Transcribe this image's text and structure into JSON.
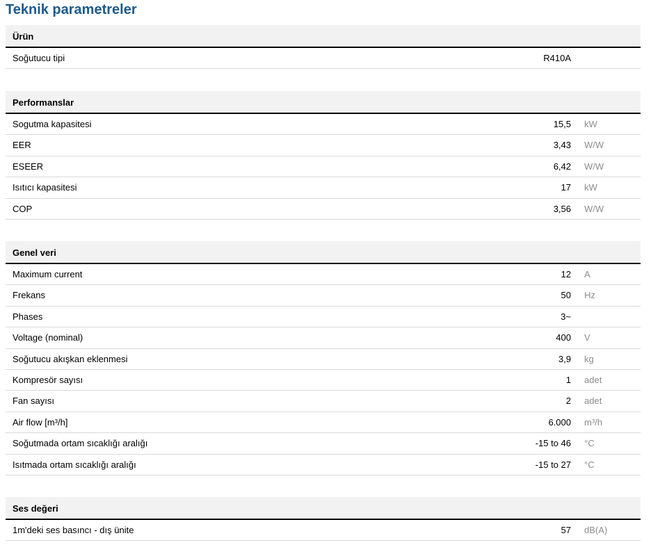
{
  "page_title": "Teknik parametreler",
  "sections": [
    {
      "title": "Ürün",
      "rows": [
        {
          "label": "Soğutucu tipi",
          "value": "R410A",
          "unit": ""
        }
      ]
    },
    {
      "title": "Performanslar",
      "rows": [
        {
          "label": "Sogutma kapasitesi",
          "value": "15,5",
          "unit": "kW"
        },
        {
          "label": "EER",
          "value": "3,43",
          "unit": "W/W"
        },
        {
          "label": "ESEER",
          "value": "6,42",
          "unit": "W/W"
        },
        {
          "label": "Isıtıcı kapasitesi",
          "value": "17",
          "unit": "kW"
        },
        {
          "label": "COP",
          "value": "3,56",
          "unit": "W/W"
        }
      ]
    },
    {
      "title": "Genel veri",
      "rows": [
        {
          "label": "Maximum current",
          "value": "12",
          "unit": "A"
        },
        {
          "label": "Frekans",
          "value": "50",
          "unit": "Hz"
        },
        {
          "label": "Phases",
          "value": "3~",
          "unit": ""
        },
        {
          "label": "Voltage (nominal)",
          "value": "400",
          "unit": "V"
        },
        {
          "label": "Soğutucu akışkan eklenmesi",
          "value": "3,9",
          "unit": "kg"
        },
        {
          "label": "Kompresör sayısı",
          "value": "1",
          "unit": "adet"
        },
        {
          "label": "Fan sayısı",
          "value": "2",
          "unit": "adet"
        },
        {
          "label": "Air flow [m³/h]",
          "value": "6.000",
          "unit": "m³/h"
        },
        {
          "label": "Soğutmada ortam sıcaklığı aralığı",
          "value": "-15 to 46",
          "unit": "°C"
        },
        {
          "label": "Isıtmada ortam sıcaklığı aralığı",
          "value": "-15 to 27",
          "unit": "°C"
        }
      ]
    },
    {
      "title": "Ses değeri",
      "rows": [
        {
          "label": "1m'deki ses basıncı - dış ünite",
          "value": "57",
          "unit": "dB(A)"
        }
      ]
    }
  ]
}
